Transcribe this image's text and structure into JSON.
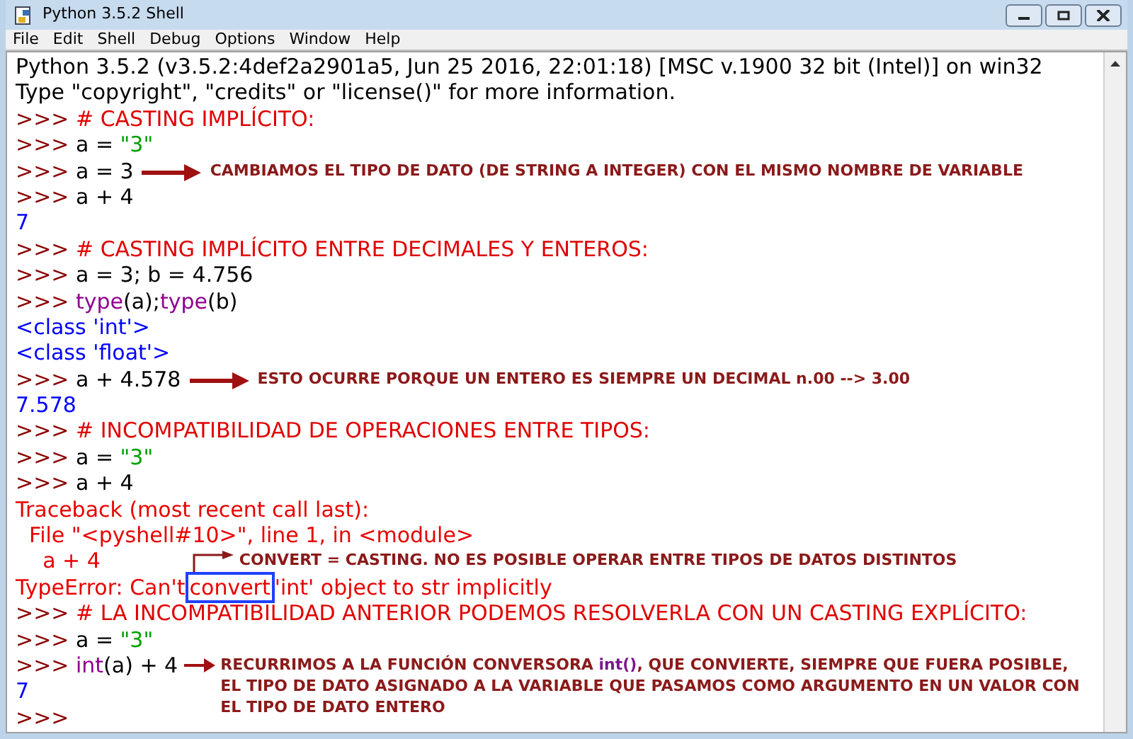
{
  "window": {
    "title": "Python 3.5.2 Shell"
  },
  "menu": [
    "File",
    "Edit",
    "Shell",
    "Debug",
    "Options",
    "Window",
    "Help"
  ],
  "lines": [
    {
      "segments": [
        {
          "kind": "stdout",
          "text": "Python 3.5.2 (v3.5.2:4def2a2901a5, Jun 25 2016, 22:01:18) [MSC v.1900 32 bit (Intel)] on win32"
        }
      ]
    },
    {
      "segments": [
        {
          "kind": "stdout",
          "text": "Type \"copyright\", \"credits\" or \"license()\" for more information."
        }
      ]
    },
    {
      "segments": [
        {
          "kind": "prompt",
          "text": ">>> "
        },
        {
          "kind": "comment",
          "text": "# CASTING IMPLÍCITO:"
        }
      ]
    },
    {
      "segments": [
        {
          "kind": "prompt",
          "text": ">>> "
        },
        {
          "kind": "code",
          "text": "a = "
        },
        {
          "kind": "string",
          "text": "\"3\""
        }
      ]
    },
    {
      "segments": [
        {
          "kind": "prompt",
          "text": ">>> "
        },
        {
          "kind": "code",
          "text": "a = 3"
        }
      ],
      "note": {
        "kind": "long",
        "parts": [
          {
            "kind": "plain",
            "text": "CAMBIAMOS EL TIPO DE DATO (DE STRING A INTEGER) CON EL MISMO NOMBRE DE VARIABLE"
          }
        ]
      }
    },
    {
      "segments": [
        {
          "kind": "prompt",
          "text": ">>> "
        },
        {
          "kind": "code",
          "text": "a + 4"
        }
      ]
    },
    {
      "segments": [
        {
          "kind": "output",
          "text": "7"
        }
      ]
    },
    {
      "segments": [
        {
          "kind": "prompt",
          "text": ">>> "
        },
        {
          "kind": "comment",
          "text": "# CASTING IMPLÍCITO ENTRE DECIMALES Y ENTEROS:"
        }
      ]
    },
    {
      "segments": [
        {
          "kind": "prompt",
          "text": ">>> "
        },
        {
          "kind": "code",
          "text": "a = 3; b = 4.756"
        }
      ]
    },
    {
      "segments": [
        {
          "kind": "prompt",
          "text": ">>> "
        },
        {
          "kind": "builtin",
          "text": "type"
        },
        {
          "kind": "code",
          "text": "(a);"
        },
        {
          "kind": "builtin",
          "text": "type"
        },
        {
          "kind": "code",
          "text": "(b)"
        }
      ]
    },
    {
      "segments": [
        {
          "kind": "output",
          "text": "<class 'int'>"
        }
      ]
    },
    {
      "segments": [
        {
          "kind": "output",
          "text": "<class 'float'>"
        }
      ]
    },
    {
      "segments": [
        {
          "kind": "prompt",
          "text": ">>> "
        },
        {
          "kind": "code",
          "text": "a + 4.578"
        }
      ],
      "note": {
        "kind": "long",
        "parts": [
          {
            "kind": "plain",
            "text": "ESTO OCURRE PORQUE UN ENTERO ES SIEMPRE UN DECIMAL n.00 --> 3.00"
          }
        ]
      }
    },
    {
      "segments": [
        {
          "kind": "output",
          "text": "7.578"
        }
      ]
    },
    {
      "segments": [
        {
          "kind": "prompt",
          "text": ">>> "
        },
        {
          "kind": "comment",
          "text": "# INCOMPATIBILIDAD DE OPERACIONES ENTRE TIPOS:"
        }
      ]
    },
    {
      "segments": [
        {
          "kind": "prompt",
          "text": ">>> "
        },
        {
          "kind": "code",
          "text": "a = "
        },
        {
          "kind": "string",
          "text": "\"3\""
        }
      ]
    },
    {
      "segments": [
        {
          "kind": "prompt",
          "text": ">>> "
        },
        {
          "kind": "code",
          "text": "a + 4"
        }
      ]
    },
    {
      "segments": [
        {
          "kind": "error",
          "text": "Traceback (most recent call last):"
        }
      ]
    },
    {
      "segments": [
        {
          "kind": "error",
          "text": "  File \"<pyshell#10>\", line 1, in <module>"
        }
      ]
    },
    {
      "segments": [
        {
          "kind": "error",
          "text": "    a + 4"
        }
      ],
      "note": {
        "kind": "elbow",
        "parts": [
          {
            "kind": "plain",
            "text": "CONVERT = CASTING. NO ES POSIBLE OPERAR ENTRE TIPOS DE DATOS DISTINTOS"
          }
        ]
      }
    },
    {
      "segments": [
        {
          "kind": "error",
          "text": "TypeError: Can't"
        },
        {
          "kind": "boxed",
          "text": "convert"
        },
        {
          "kind": "error",
          "text": "'int' object to str implicitly"
        }
      ]
    },
    {
      "segments": [
        {
          "kind": "prompt",
          "text": ">>> "
        },
        {
          "kind": "comment",
          "text": "# LA INCOMPATIBILIDAD ANTERIOR PODEMOS RESOLVERLA CON UN CASTING EXPLÍCITO:"
        }
      ]
    },
    {
      "segments": [
        {
          "kind": "prompt",
          "text": ">>> "
        },
        {
          "kind": "code",
          "text": "a = "
        },
        {
          "kind": "string",
          "text": "\"3\""
        }
      ]
    },
    {
      "segments": [
        {
          "kind": "prompt",
          "text": ">>> "
        },
        {
          "kind": "builtin",
          "text": "int"
        },
        {
          "kind": "code",
          "text": "(a) + 4"
        }
      ],
      "note": {
        "kind": "short",
        "parts": [
          {
            "kind": "plain",
            "text": "RECURRIMOS A LA FUNCIÓN CONVERSORA "
          },
          {
            "kind": "builtin",
            "text": "int()"
          },
          {
            "kind": "plain",
            "text": ", QUE CONVIERTE, SIEMPRE QUE FUERA POSIBLE, EL TIPO DE DATO ASIGNADO A LA VARIABLE QUE PASAMOS COMO ARGUMENTO EN UN VALOR CON EL TIPO DE DATO ENTERO"
          }
        ]
      }
    },
    {
      "segments": [
        {
          "kind": "output",
          "text": "7"
        }
      ]
    },
    {
      "segments": [
        {
          "kind": "prompt",
          "text": ">>>"
        }
      ]
    }
  ]
}
